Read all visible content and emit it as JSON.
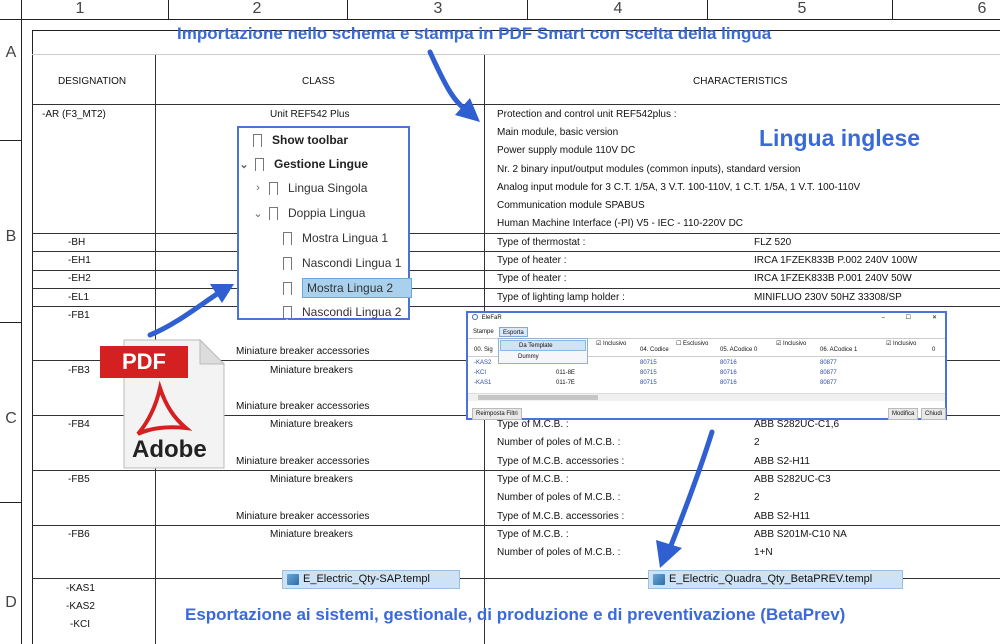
{
  "ruler": {
    "columns": [
      "1",
      "2",
      "3",
      "4",
      "5",
      "6"
    ],
    "rows": [
      "A",
      "B",
      "C",
      "D"
    ]
  },
  "headers": {
    "designation": "DESIGNATION",
    "class": "CLASS",
    "characteristics": "CHARACTERISTICS"
  },
  "annotations": {
    "top_title": "Importazione nello schema e stampa in PDF Smart con scelta della lingua",
    "language_label": "Lingua inglese",
    "bottom_title": "Esportazione ai sistemi, gestionale, di produzione e di preventivazione (BetaPrev)"
  },
  "rows": [
    {
      "designation": "-AR (F3_MT2)",
      "class": "Unit REF542 Plus"
    },
    {
      "designation": "-BH"
    },
    {
      "designation": "-EH1"
    },
    {
      "designation": "-EH2"
    },
    {
      "designation": "-EL1"
    },
    {
      "designation": "-FB1"
    },
    {
      "designation": "-FB3",
      "class": "Miniature breakers"
    },
    {
      "designation": "-FB4",
      "class": "Miniature breakers"
    },
    {
      "designation": "-FB5",
      "class": "Miniature breakers"
    },
    {
      "designation": "-FB6",
      "class": "Miniature breakers"
    }
  ],
  "class_accessories": [
    "Miniature breaker accessories",
    "Miniature breaker accessories",
    "Miniature breaker accessories",
    "Miniature breaker accessories"
  ],
  "kas_list": [
    "-KAS1",
    "-KAS2",
    "-KCI"
  ],
  "ar_characteristics": [
    "Protection and control unit REF542plus :",
    "Main module, basic version",
    "Power supply module 110V DC",
    "Nr. 2 binary input/output modules (common inputs), standard version",
    "Analog input module for 3 C.T. 1/5A, 3 V.T. 100-110V, 1 C.T. 1/5A, 1 V.T. 100-110V",
    "Communication module SPABUS",
    "Human Machine Interface (-PI) V5 - IEC - 110-220V DC"
  ],
  "char_pairs": [
    {
      "label": "Type of thermostat :",
      "value": "FLZ 520"
    },
    {
      "label": "Type of heater :",
      "value": "IRCA 1FZEK833B P.002 240V 100W"
    },
    {
      "label": "Type of heater :",
      "value": "IRCA 1FZEK833B P.001 240V 50W"
    },
    {
      "label": "Type of lighting lamp holder :",
      "value": "MINIFLUO 230V 50HZ 33308/SP"
    },
    {
      "label": "Type of M.C.B. :",
      "value": "ABB S282UC-C1,6"
    },
    {
      "label": "Number of poles of M.C.B. :",
      "value": "2"
    },
    {
      "label": "Type of M.C.B. accessories :",
      "value": "ABB S2-H11"
    },
    {
      "label": "Type of M.C.B. :",
      "value": "ABB S282UC-C3"
    },
    {
      "label": "Number of poles of M.C.B. :",
      "value": "2"
    },
    {
      "label": "Type of M.C.B. accessories :",
      "value": "ABB S2-H11"
    },
    {
      "label": "Type of M.C.B. :",
      "value": "ABB S201M-C10 NA"
    },
    {
      "label": "Number of poles of M.C.B. :",
      "value": "1+N"
    }
  ],
  "bookmarks": [
    {
      "label": "Show toolbar",
      "chevron": ""
    },
    {
      "label": "Gestione Lingue",
      "chevron": "⌄"
    },
    {
      "label": "Lingua Singola",
      "chevron": "›"
    },
    {
      "label": "Doppia Lingua",
      "chevron": "⌄"
    },
    {
      "label": "Mostra Lingua 1",
      "chevron": ""
    },
    {
      "label": "Nascondi Lingua 1",
      "chevron": ""
    },
    {
      "label": "Mostra Lingua 2",
      "chevron": ""
    },
    {
      "label": "Nascondi Lingua 2",
      "chevron": ""
    }
  ],
  "pdf_icon": {
    "badge": "PDF",
    "brand": "Adobe"
  },
  "elefar": {
    "title": "EleFaR",
    "controls": [
      "–",
      "☐",
      "✕"
    ],
    "tabs": [
      "Stampe",
      "Esporta"
    ],
    "menu": [
      "Da Template",
      "Dummy"
    ],
    "columns": [
      "00. Sig",
      "04. Codice",
      "05. ACodice 0",
      "06. ACodice 1",
      "0"
    ],
    "checks": [
      "Inclusivo",
      "Esclusivo",
      "Inclusivo",
      "Inclusivo"
    ],
    "grid": [
      {
        "sig": "-KAS2",
        "c1": "011-7E",
        "c2": "80715",
        "c3": "80716",
        "c4": "80877"
      },
      {
        "sig": "-KCI",
        "c1": "011-8E",
        "c2": "80715",
        "c3": "80716",
        "c4": "80877"
      },
      {
        "sig": "-KAS1",
        "c1": "011-7E",
        "c2": "80715",
        "c3": "80716",
        "c4": "80877"
      }
    ],
    "reset_filters": "Reimposta Filtri",
    "modify": "Modifica",
    "close": "Chiudi"
  },
  "files": [
    {
      "name": "E_Electric_Qty-SAP.templ"
    },
    {
      "name": "E_Electric_Quadra_Qty_BetaPREV.templ"
    }
  ],
  "colors": {
    "accent": "#3a6ad8",
    "panel_border": "#4a72d8",
    "pdf_red": "#d42020",
    "selected": "#a9d0ec",
    "file_bg": "#cde2f4"
  }
}
